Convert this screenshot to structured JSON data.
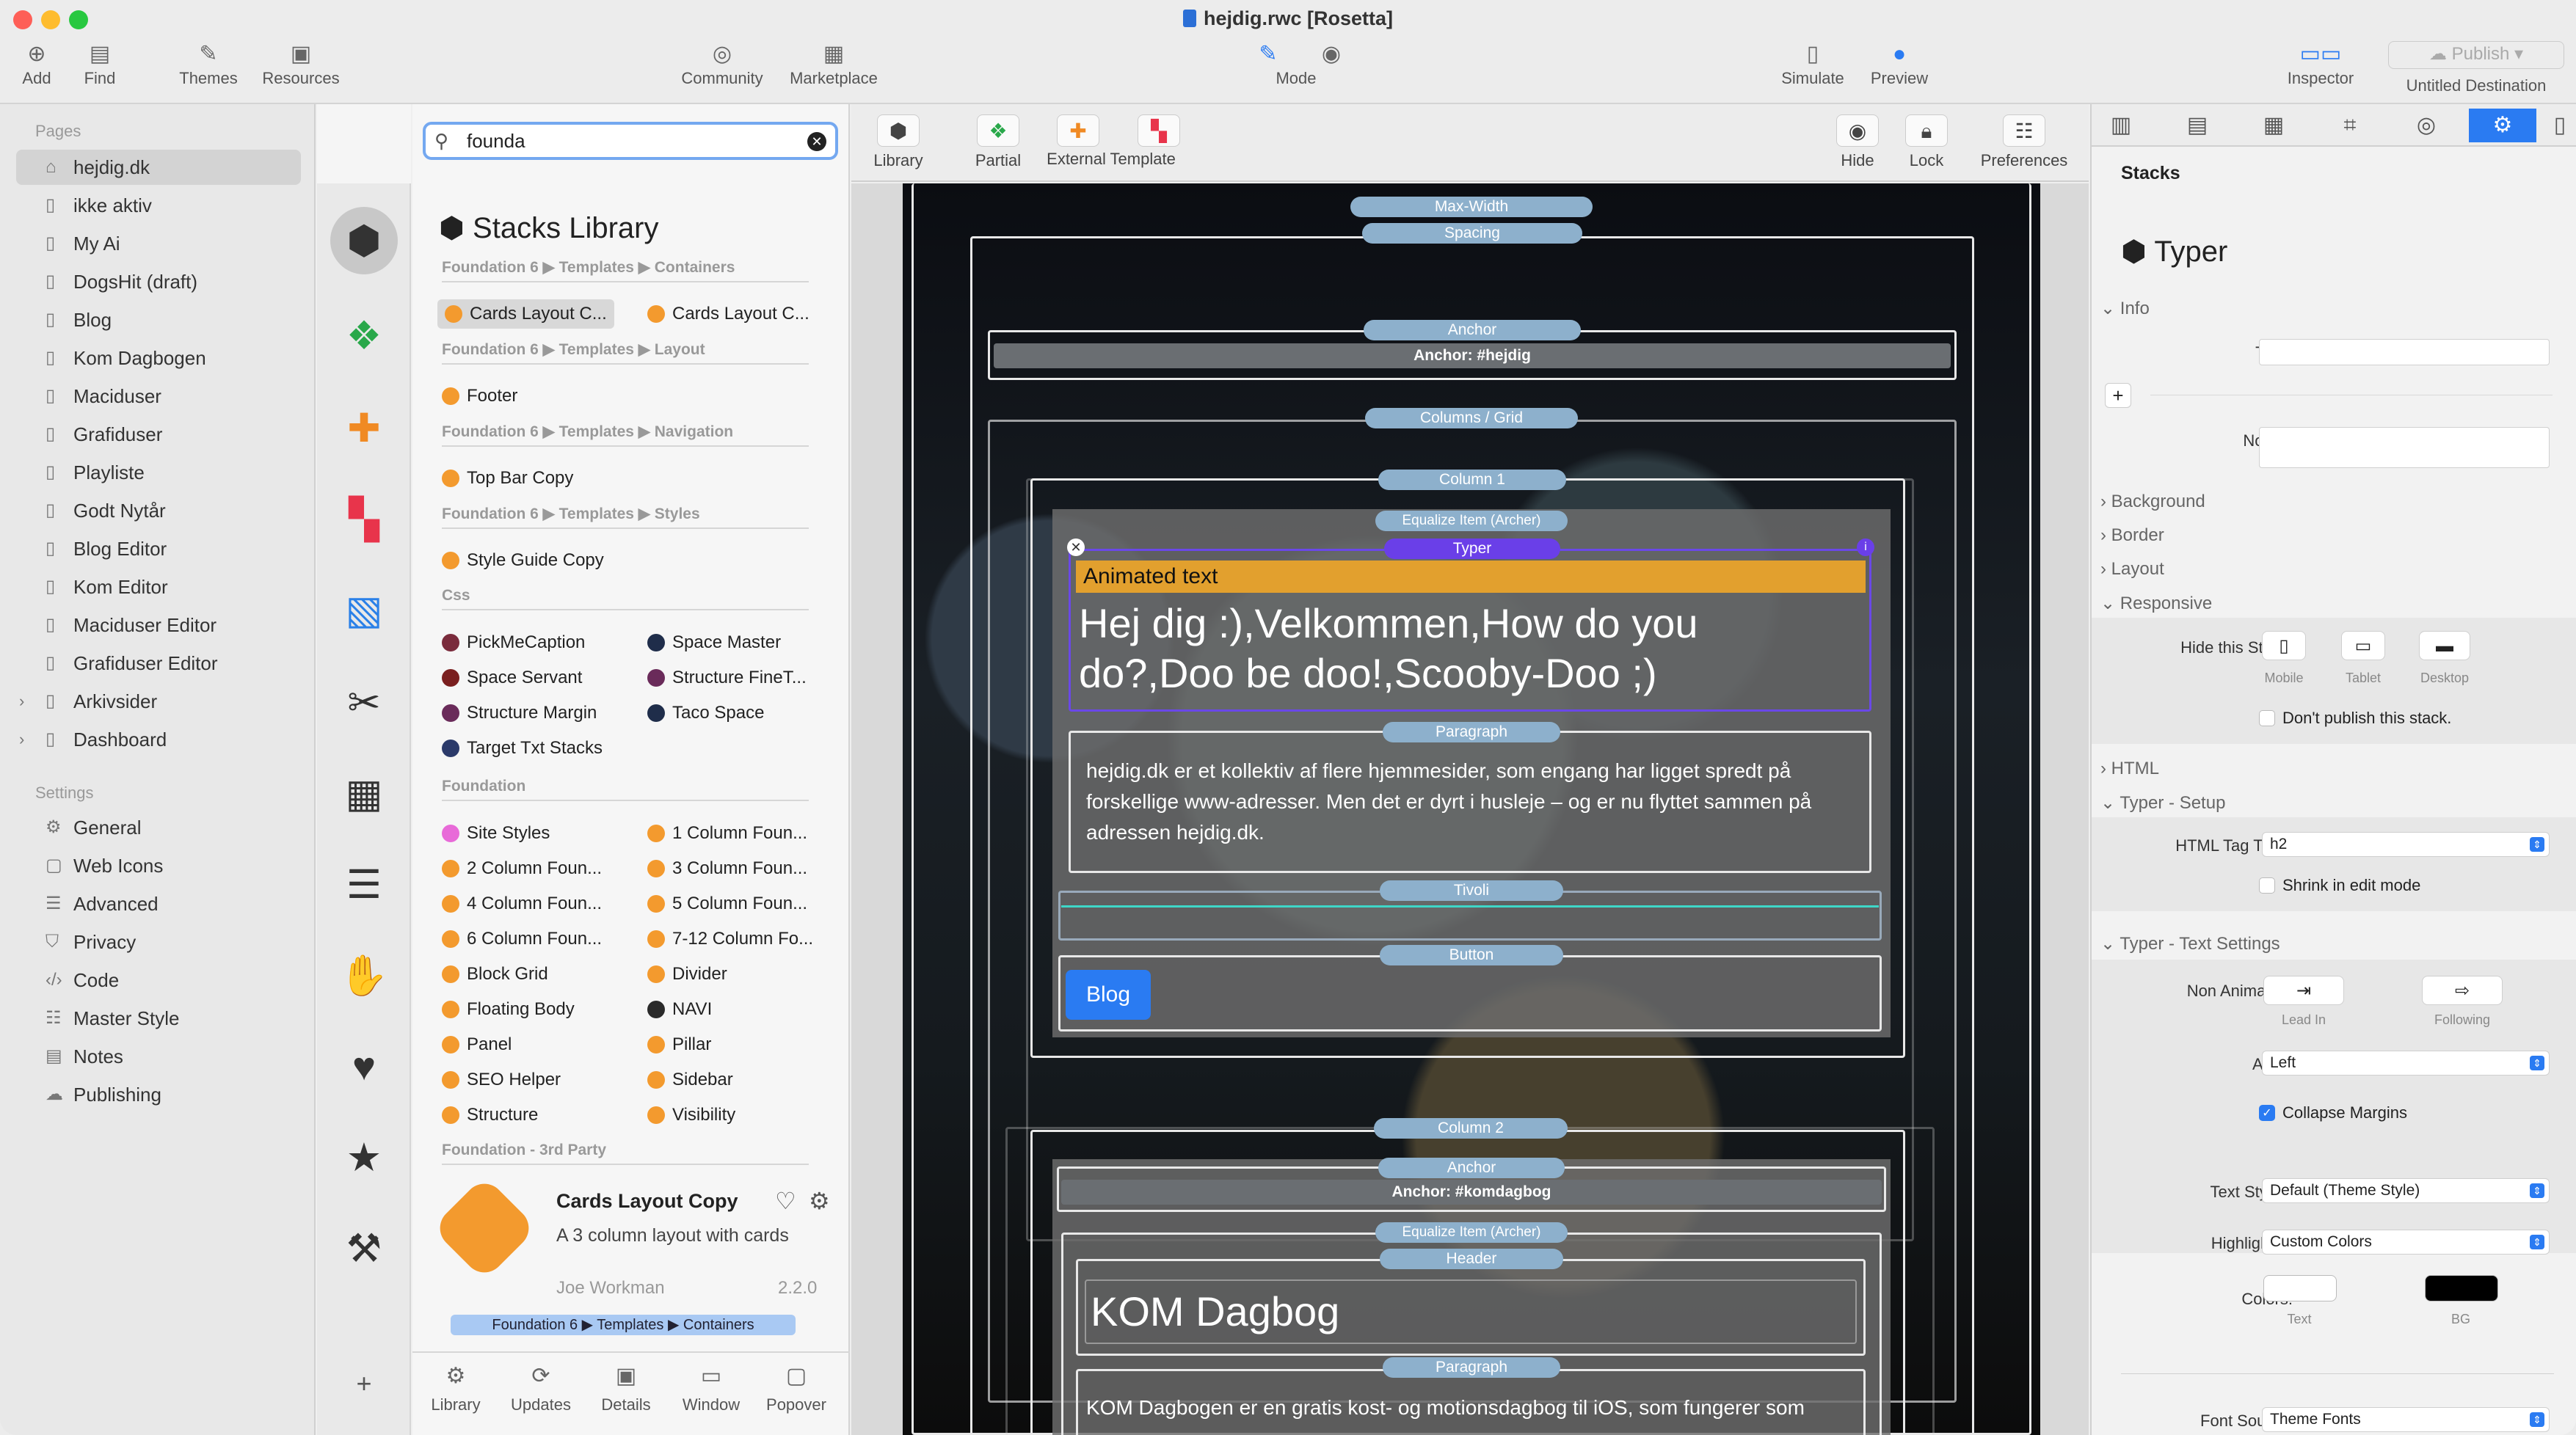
{
  "window": {
    "title": "hejdig.rwc [Rosetta]"
  },
  "toolbar": {
    "add": "Add",
    "find": "Find",
    "themes": "Themes",
    "resources": "Resources",
    "community": "Community",
    "marketplace": "Marketplace",
    "mode": "Mode",
    "simulate": "Simulate",
    "preview": "Preview",
    "inspector": "Inspector",
    "publish": "Publish",
    "destination": "Untitled Destination"
  },
  "sidebar": {
    "pages_header": "Pages",
    "pages": [
      "hejdig.dk",
      "ikke aktiv",
      "My Ai",
      "DogsHit (draft)",
      "Blog",
      "Kom Dagbogen",
      "Maciduser",
      "Grafiduser",
      "Playliste",
      "Godt Nytår",
      "Blog Editor",
      "Kom Editor",
      "Maciduser Editor",
      "Grafiduser Editor",
      "Arkivsider",
      "Dashboard"
    ],
    "settings_header": "Settings",
    "settings": [
      "General",
      "Web Icons",
      "Advanced",
      "Privacy",
      "Code",
      "Master Style",
      "Notes",
      "Publishing"
    ]
  },
  "library": {
    "search_value": "founda",
    "title": "Stacks Library",
    "categories": [
      "Foundation 6 ▶ Templates ▶ Containers",
      "Foundation 6 ▶ Templates ▶ Layout",
      "Foundation 6 ▶ Templates ▶ Navigation",
      "Foundation 6 ▶ Templates ▶ Styles",
      "Css",
      "Foundation",
      "Foundation - 3rd Party"
    ],
    "containers": [
      "Cards Layout C...",
      "Cards Layout C..."
    ],
    "layout": [
      "Footer"
    ],
    "navigation": [
      "Top Bar Copy"
    ],
    "styles": [
      "Style Guide Copy"
    ],
    "css": [
      "PickMeCaption",
      "Space Master",
      "Space Servant",
      "Structure FineT...",
      "Structure Margin",
      "Taco Space",
      "Target Txt Stacks"
    ],
    "foundation": [
      "Site Styles",
      "1 Column Foun...",
      "2 Column Foun...",
      "3 Column Foun...",
      "4 Column Foun...",
      "5 Column Foun...",
      "6 Column Foun...",
      "7-12 Column Fo...",
      "Block Grid",
      "Divider",
      "Floating Body",
      "NAVI",
      "Panel",
      "Pillar",
      "SEO Helper",
      "Sidebar",
      "Structure",
      "Visibility"
    ],
    "detail": {
      "title": "Cards Layout Copy",
      "desc": "A 3 column layout with cards",
      "author": "Joe Workman",
      "version": "2.2.0",
      "path": "Foundation 6 ▶ Templates ▶ Containers"
    },
    "tabs": [
      "Library",
      "Updates",
      "Details",
      "Window",
      "Popover"
    ]
  },
  "canvas_toolbar": {
    "library": "Library",
    "partial": "Partial",
    "external": "External Template",
    "hide": "Hide",
    "lock": "Lock",
    "preferences": "Preferences"
  },
  "canvas": {
    "labels": {
      "max_width": "Max-Width",
      "spacing": "Spacing",
      "anchor": "Anchor",
      "anchor1": "Anchor: #hejdig",
      "columns": "Columns / Grid",
      "column1": "Column 1",
      "equalize": "Equalize Item (Archer)",
      "typer": "Typer",
      "paragraph": "Paragraph",
      "tivoli": "Tivoli",
      "button": "Button",
      "column2": "Column 2",
      "anchor2": "Anchor: #komdagbog",
      "header": "Header"
    },
    "animated_text": "Animated text",
    "typer_heading": "Hej dig :),Velkommen,How do you do?,Doo be doo!,Scooby-Doo ;)",
    "para1": "hejdig.dk er et kollektiv af flere hjemmesider, som engang har ligget spredt på forskellige www-adresser. Men det er dyrt i husleje – og er nu flyttet sammen på adressen hejdig.dk.",
    "blog_button": "Blog",
    "kom_heading": "KOM Dagbog",
    "para2": "KOM Dagbogen er en gratis kost- og motionsdagbog til iOS, som fungerer som"
  },
  "inspector": {
    "section": "Stacks",
    "stack_name": "Typer",
    "info": "Info",
    "title_label": "Title:",
    "notes_label": "Notes:",
    "background": "Background",
    "border": "Border",
    "layout": "Layout",
    "responsive": "Responsive",
    "hide_label": "Hide this Stack:",
    "mobile": "Mobile",
    "tablet": "Tablet",
    "desktop": "Desktop",
    "dont_publish": "Don't publish this stack.",
    "html": "HTML",
    "setup": "Typer - Setup",
    "tag_label": "HTML Tag Type:",
    "tag_value": "h2",
    "shrink": "Shrink in edit mode",
    "text_settings": "Typer - Text Settings",
    "non_animated": "Non Animated:",
    "lead_in": "Lead In",
    "following": "Following",
    "align_label": "Align:",
    "align_value": "Left",
    "collapse": "Collapse Margins",
    "text_styles_label": "Text Styles:",
    "text_styles_value": "Default (Theme Style)",
    "highlighter_label": "Highlighter:",
    "highlighter_value": "Custom Colors",
    "colors_label": "Colors:",
    "text": "Text",
    "bg": "BG",
    "font_source_label": "Font Source:",
    "font_source_value": "Theme Fonts",
    "colors": {
      "text": "#ffffff",
      "bg": "#000000"
    }
  }
}
